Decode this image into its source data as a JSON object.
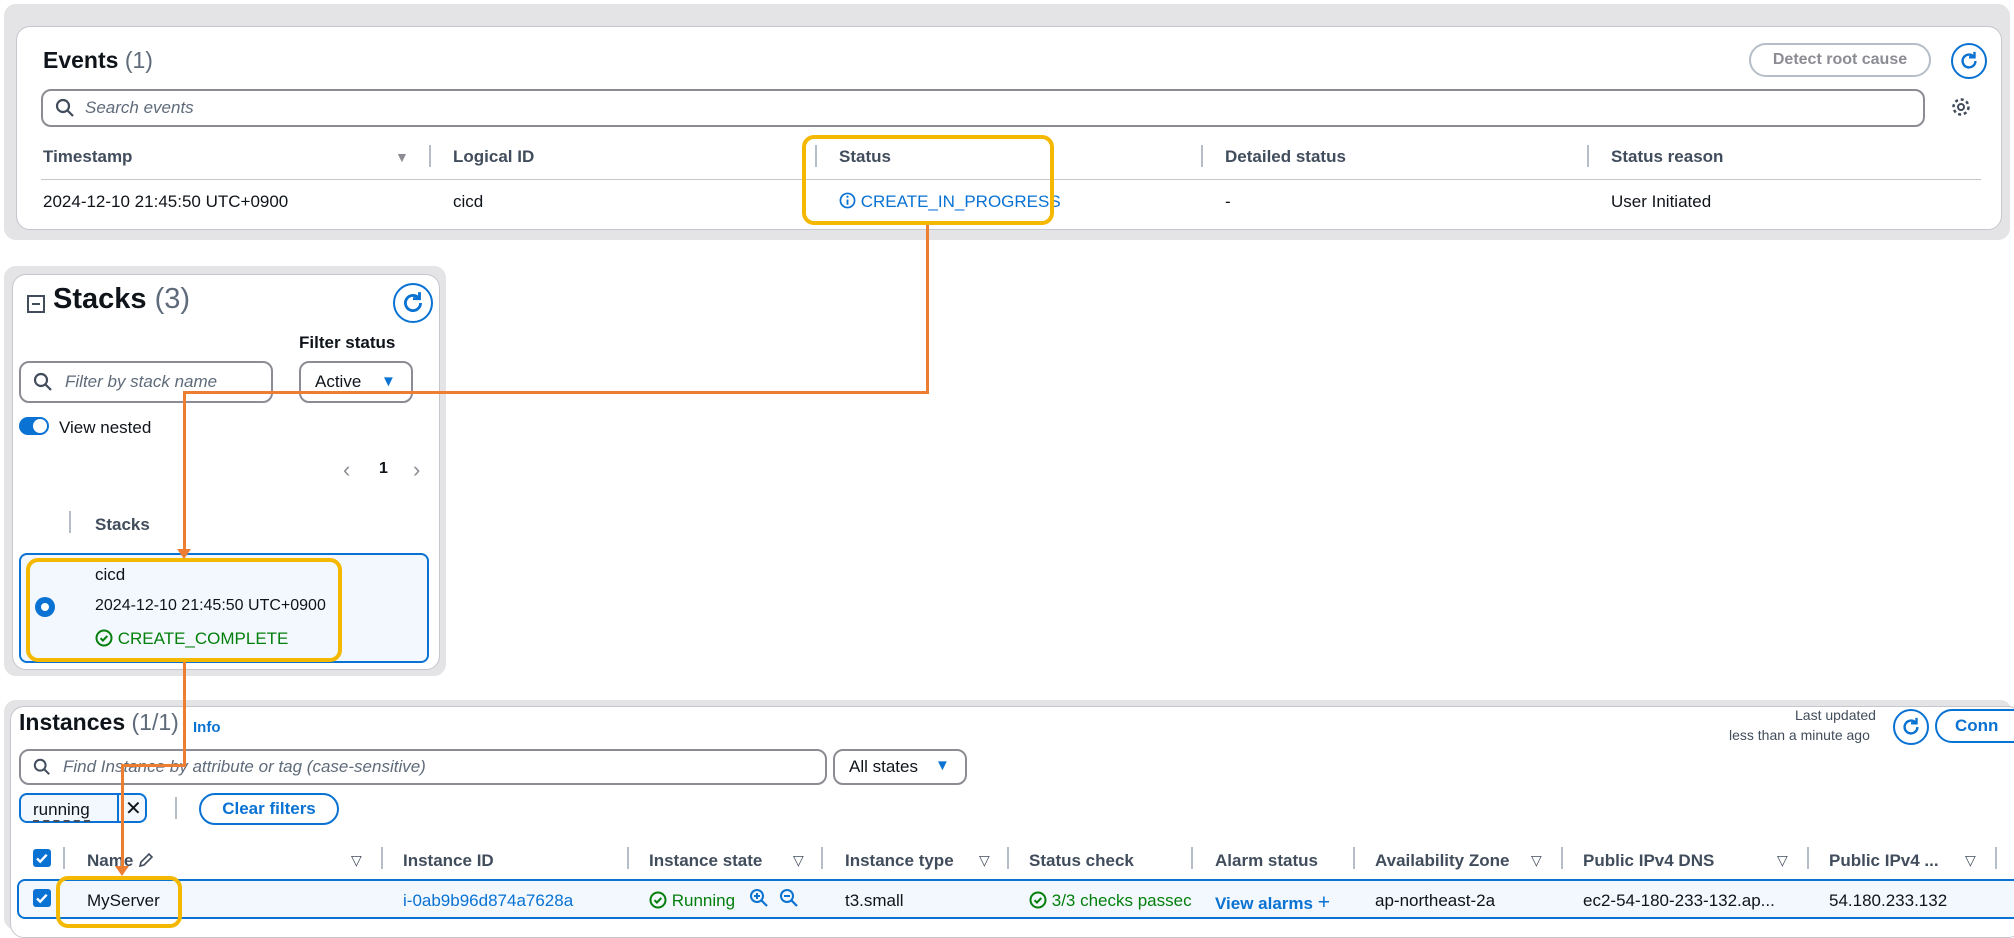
{
  "events": {
    "title": "Events",
    "count": "(1)",
    "detect_button": "Detect root cause",
    "search_placeholder": "Search events",
    "columns": [
      "Timestamp",
      "Logical ID",
      "Status",
      "Detailed status",
      "Status reason"
    ],
    "row": {
      "timestamp": "2024-12-10 21:45:50 UTC+0900",
      "logical_id": "cicd",
      "status": "CREATE_IN_PROGRESS",
      "detailed_status": "-",
      "status_reason": "User Initiated"
    }
  },
  "stacks": {
    "title": "Stacks",
    "count": "(3)",
    "filter_label": "Filter status",
    "search_placeholder": "Filter by stack name",
    "filter_value": "Active",
    "view_nested": "View nested",
    "page": "1",
    "column": "Stacks",
    "item": {
      "name": "cicd",
      "timestamp": "2024-12-10 21:45:50 UTC+0900",
      "status": "CREATE_COMPLETE"
    }
  },
  "instances": {
    "title": "Instances",
    "count": "(1/1)",
    "info": "Info",
    "last_updated_label": "Last updated",
    "last_updated_value": "less than a minute ago",
    "connect_button": "Conn",
    "search_placeholder": "Find Instance by attribute or tag (case-sensitive)",
    "states_select": "All states",
    "filter_token": "running",
    "clear_filters": "Clear filters",
    "columns": [
      "Name",
      "Instance ID",
      "Instance state",
      "Instance type",
      "Status check",
      "Alarm status",
      "Availability Zone",
      "Public IPv4 DNS",
      "Public IPv4 ..."
    ],
    "row": {
      "name": "MyServer",
      "instance_id": "i-0ab9b96d874a7628a",
      "state": "Running",
      "type": "t3.small",
      "status_check": "3/3 checks passec",
      "alarm": "View alarms",
      "az": "ap-northeast-2a",
      "dns": "ec2-54-180-233-132.ap...",
      "ip": "54.180.233.132"
    }
  },
  "colors": {
    "accent": "#0972d3",
    "success": "#037f0c",
    "highlight": "#f5b800",
    "connector": "#ed7d31"
  }
}
